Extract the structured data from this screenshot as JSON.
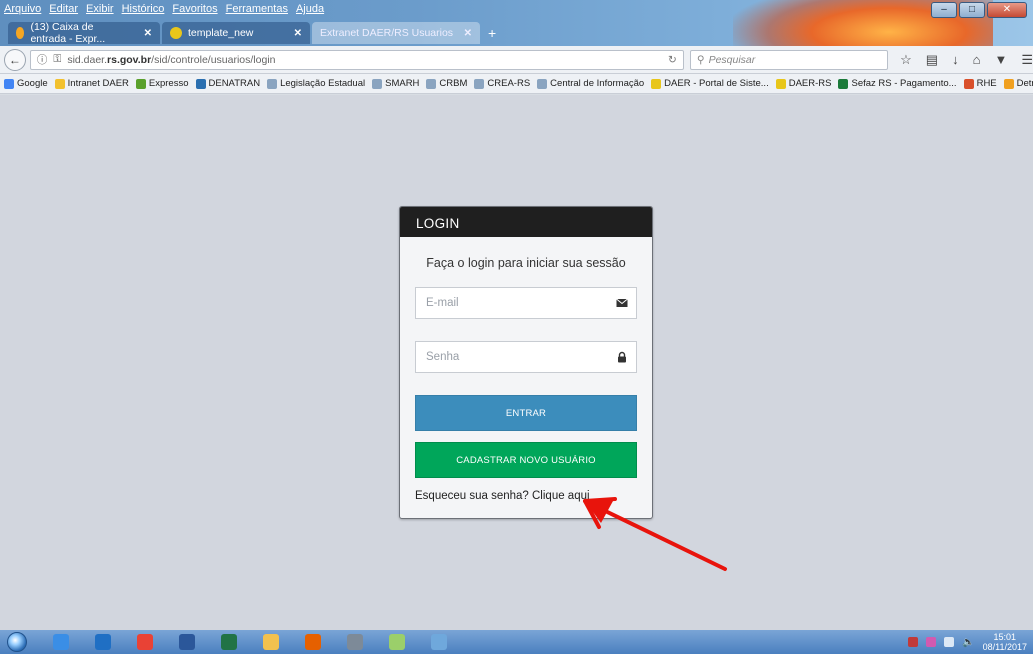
{
  "menu": [
    "Arquivo",
    "Editar",
    "Exibir",
    "Histórico",
    "Favoritos",
    "Ferramentas",
    "Ajuda"
  ],
  "tabs": [
    {
      "label": "(13) Caixa de entrada - Expr...",
      "color": "#f5a623"
    },
    {
      "label": "template_new",
      "color": "#e8c61a"
    },
    {
      "label": "Extranet DAER/RS Usuarios",
      "color": "#7fb3e0"
    }
  ],
  "newtab": "+",
  "url": {
    "prefix": "sid.daer.",
    "host": "rs.gov.br",
    "path": "/sid/controle/usuarios/login"
  },
  "search_placeholder": "Pesquisar",
  "bookmarks": [
    {
      "label": "Google",
      "color": "#4285f4"
    },
    {
      "label": "Intranet DAER",
      "color": "#f2c12e"
    },
    {
      "label": "Expresso",
      "color": "#5aa02c"
    },
    {
      "label": "DENATRAN",
      "color": "#2a6fb0"
    },
    {
      "label": "Legislação Estadual",
      "color": "#8aa4c0"
    },
    {
      "label": "SMARH",
      "color": "#8aa4c0"
    },
    {
      "label": "CRBM",
      "color": "#8aa4c0"
    },
    {
      "label": "CREA-RS",
      "color": "#8aa4c0"
    },
    {
      "label": "Central de Informação",
      "color": "#8aa4c0"
    },
    {
      "label": "DAER - Portal de Siste...",
      "color": "#e8c61a"
    },
    {
      "label": "DAER-RS",
      "color": "#e8c61a"
    },
    {
      "label": "Sefaz RS - Pagamento...",
      "color": "#1b7a3a"
    },
    {
      "label": "RHE",
      "color": "#d9502b"
    },
    {
      "label": "Detran RS",
      "color": "#f0a020"
    }
  ],
  "login": {
    "header": "LOGIN",
    "message": "Faça o login para iniciar sua sessão",
    "email_placeholder": "E-mail",
    "password_placeholder": "Senha",
    "submit_label": "ENTRAR",
    "register_label": "CADASTRAR NOVO USUÁRIO",
    "forgot_label": "Esqueceu sua senha? Clique aqui"
  },
  "taskbar_apps": [
    {
      "name": "ie-icon",
      "color": "#3a8ee6"
    },
    {
      "name": "outlook-icon",
      "color": "#1f6fc4"
    },
    {
      "name": "chrome-icon",
      "color": "#e94235"
    },
    {
      "name": "word-icon",
      "color": "#2b579a"
    },
    {
      "name": "excel-icon",
      "color": "#217346"
    },
    {
      "name": "explorer-icon",
      "color": "#f2c14e"
    },
    {
      "name": "firefox-icon",
      "color": "#e66000"
    },
    {
      "name": "calculator-icon",
      "color": "#7d8a98"
    },
    {
      "name": "folder-icon",
      "color": "#9bcf6a"
    },
    {
      "name": "mail-icon",
      "color": "#6fa8dc"
    }
  ],
  "clock": {
    "time": "15:01",
    "date": "08/11/2017"
  },
  "colors": {
    "primary": "#3c8dbc",
    "success": "#00a65a",
    "header": "#1f1f1f",
    "annotation": "#e8140c"
  }
}
